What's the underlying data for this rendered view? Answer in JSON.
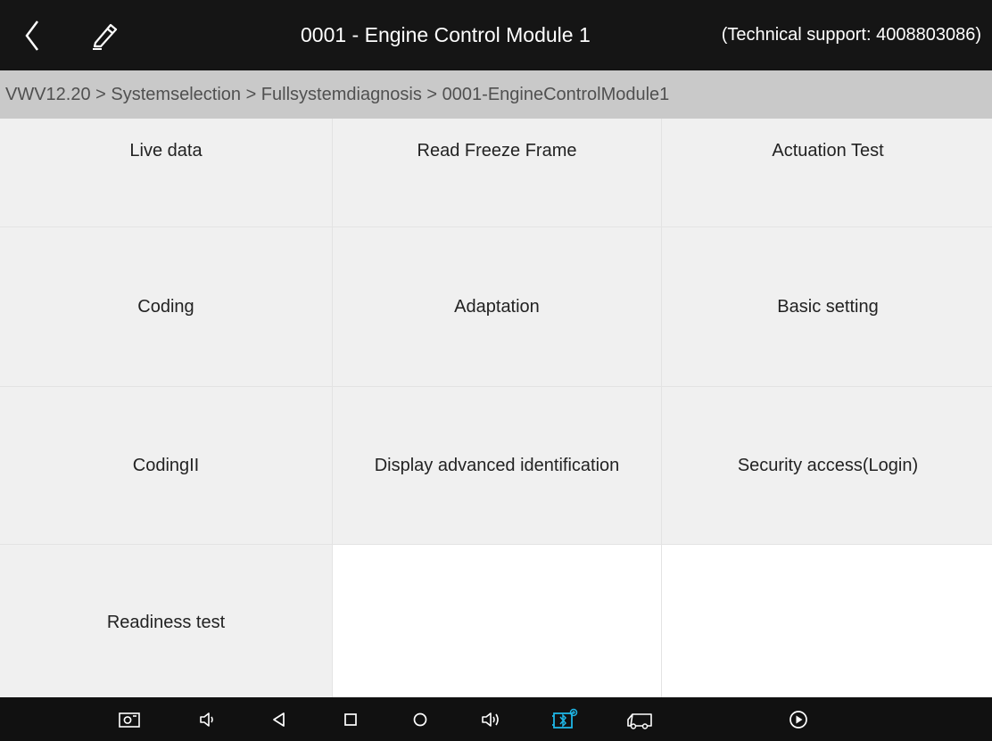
{
  "header": {
    "title": "0001 - Engine Control Module 1",
    "support": "(Technical support: 4008803086)",
    "back_icon": "chevron-left-icon",
    "edit_icon": "pen-icon"
  },
  "breadcrumb": {
    "text": "VWV12.20 > Systemselection > Fullsystemdiagnosis > 0001-EngineControlModule1"
  },
  "menu": {
    "items": [
      {
        "label": "Live data"
      },
      {
        "label": "Read Freeze Frame"
      },
      {
        "label": "Actuation Test"
      },
      {
        "label": "Coding"
      },
      {
        "label": "Adaptation"
      },
      {
        "label": "Basic setting"
      },
      {
        "label": "CodingII"
      },
      {
        "label": "Display advanced identification"
      },
      {
        "label": "Security access(Login)"
      },
      {
        "label": "Readiness test"
      }
    ]
  },
  "navbar": {
    "icons": [
      "screenshot-icon",
      "volume-down-icon",
      "back-triangle-icon",
      "recents-square-icon",
      "home-circle-icon",
      "volume-up-icon",
      "bluetooth-vci-icon",
      "truck-icon",
      "play-icon"
    ]
  },
  "colors": {
    "topbar": "#151515",
    "breadcrumb_bg": "#c9c9c9",
    "cell_bg": "#f0f0f0",
    "accent_bluetooth": "#1fb6e6"
  }
}
